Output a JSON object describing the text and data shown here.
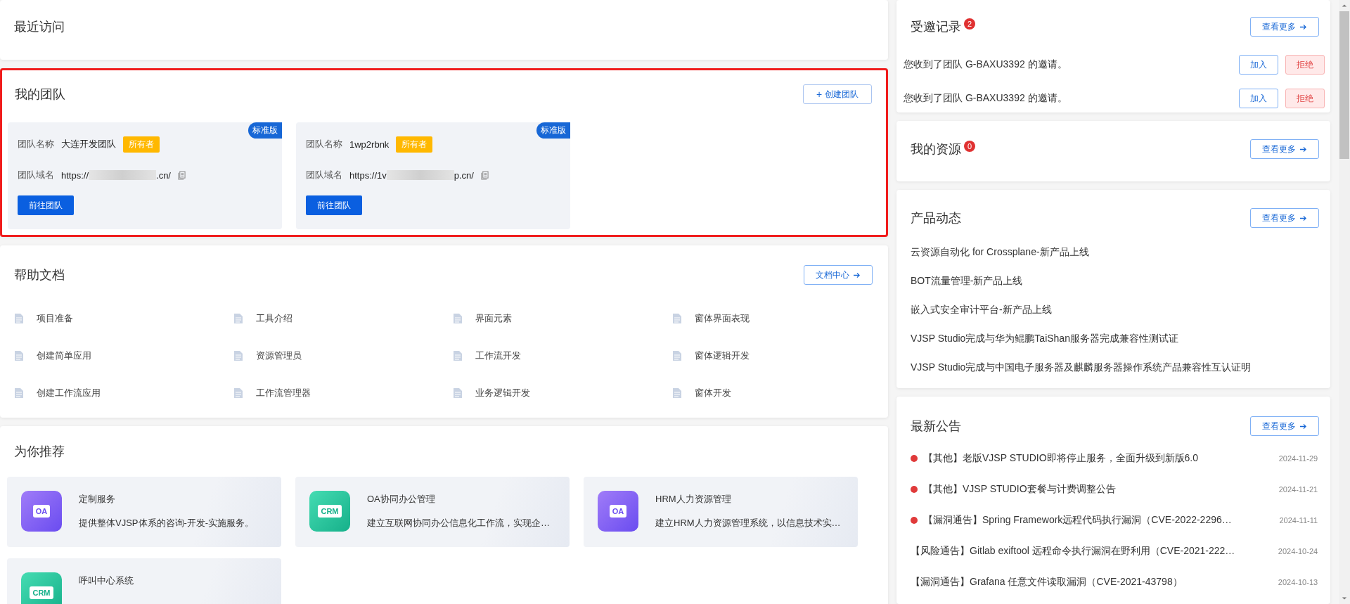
{
  "recent": {
    "title": "最近访问"
  },
  "teams": {
    "title": "我的团队",
    "create_button": {
      "icon": "+",
      "label": "创建团队"
    },
    "items": [
      {
        "edition": "标准版",
        "name_label": "团队名称",
        "name": "大连开发团队",
        "role": "所有者",
        "domain_label": "团队域名",
        "url_prefix": "https://",
        "url_suffix": ".cn/",
        "button": "前往团队"
      },
      {
        "edition": "标准版",
        "name_label": "团队名称",
        "name": "1wp2rbnk",
        "role": "所有者",
        "domain_label": "团队域名",
        "url_prefix": "https://1v",
        "url_suffix": "p.cn/",
        "button": "前往团队"
      }
    ]
  },
  "help": {
    "title": "帮助文档",
    "button": "文档中心",
    "docs": [
      "项目准备",
      "工具介绍",
      "界面元素",
      "窗体界面表现",
      "创建简单应用",
      "资源管理员",
      "工作流开发",
      "窗体逻辑开发",
      "创建工作流应用",
      "工作流管理器",
      "业务逻辑开发",
      "窗体开发"
    ]
  },
  "recommend": {
    "title": "为你推荐",
    "items": [
      {
        "kind": "oa",
        "icon_label": "OA",
        "title": "定制服务",
        "desc": "提供整体VJSP体系的咨询-开发-实施服务。"
      },
      {
        "kind": "crm",
        "icon_label": "CRM",
        "title": "OA协同办公管理",
        "desc": "建立互联网协同办公信息化工作流，实现企…"
      },
      {
        "kind": "oa",
        "icon_label": "OA",
        "title": "HRM人力资源管理",
        "desc": "建立HRM人力资源管理系统，以信息技术实…"
      },
      {
        "kind": "crm",
        "icon_label": "CRM",
        "title": "呼叫中心系统"
      }
    ]
  },
  "invites": {
    "title": "受邀记录",
    "count": "2",
    "more": "查看更多",
    "items": [
      {
        "text": "您收到了团队 G-BAXU3392 的邀请。",
        "accept": "加入",
        "reject": "拒绝"
      },
      {
        "text": "您收到了团队 G-BAXU3392 的邀请。",
        "accept": "加入",
        "reject": "拒绝"
      }
    ]
  },
  "resources": {
    "title": "我的资源",
    "count": "0",
    "more": "查看更多"
  },
  "news": {
    "title": "产品动态",
    "more": "查看更多",
    "items": [
      "云资源自动化 for Crossplane-新产品上线",
      "BOT流量管理-新产品上线",
      "嵌入式安全审计平台-新产品上线",
      "VJSP Studio完成与华为鲲鹏TaiShan服务器完成兼容性测试证",
      "VJSP Studio完成与中国电子服务器及麒麟服务器操作系统产品兼容性互认证明"
    ]
  },
  "notices": {
    "title": "最新公告",
    "more": "查看更多",
    "items": [
      {
        "unread": true,
        "text": "【其他】老版VJSP STUDIO即将停止服务，全面升级到新版6.0",
        "date": "2024-11-29"
      },
      {
        "unread": true,
        "text": "【其他】VJSP STUDIO套餐与计费调整公告",
        "date": "2024-11-21"
      },
      {
        "unread": true,
        "text": "【漏洞通告】Spring Framework远程代码执行漏洞（CVE-2022-2296…",
        "date": "2024-11-11"
      },
      {
        "unread": false,
        "text": "【风险通告】Gitlab exiftool 远程命令执行漏洞在野利用（CVE-2021-222…",
        "date": "2024-10-24"
      },
      {
        "unread": false,
        "text": "【漏洞通告】Grafana 任意文件读取漏洞（CVE-2021-43798）",
        "date": "2024-10-13"
      }
    ]
  }
}
